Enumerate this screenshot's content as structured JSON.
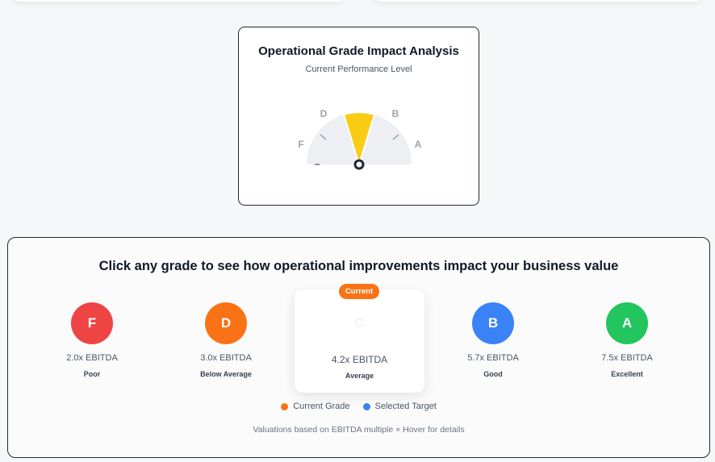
{
  "gauge": {
    "title": "Operational Grade Impact Analysis",
    "subtitle": "Current Performance Level",
    "labels": {
      "f": "F",
      "d": "D",
      "b": "B",
      "a": "A"
    },
    "current_grade": "C",
    "needle_color": "#facc15"
  },
  "panel": {
    "heading": "Click any grade to see how operational improvements impact your business value",
    "badge": "Current",
    "grades": [
      {
        "letter": "F",
        "multiple": "2.0x EBITDA",
        "label": "Poor",
        "color": "#ef4444"
      },
      {
        "letter": "D",
        "multiple": "3.0x EBITDA",
        "label": "Below Average",
        "color": "#f97316"
      },
      {
        "letter": "C",
        "multiple": "4.2x EBITDA",
        "label": "Average",
        "color": "#ffffff"
      },
      {
        "letter": "B",
        "multiple": "5.7x EBITDA",
        "label": "Good",
        "color": "#3b82f6"
      },
      {
        "letter": "A",
        "multiple": "7.5x EBITDA",
        "label": "Excellent",
        "color": "#22c55e"
      }
    ],
    "legend": {
      "current": "Current Grade",
      "current_color": "#f97316",
      "target": "Selected Target",
      "target_color": "#3b82f6"
    },
    "footer": "Valuations based on EBITDA multiple × Hover for details"
  }
}
